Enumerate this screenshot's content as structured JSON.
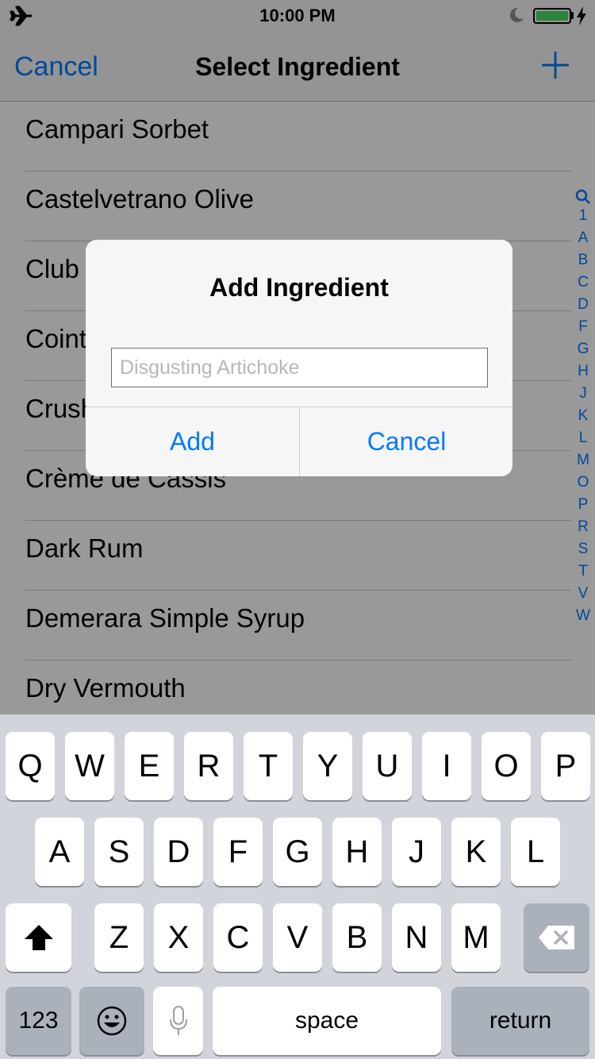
{
  "status_bar": {
    "time": "10:00 PM"
  },
  "nav": {
    "cancel": "Cancel",
    "title": "Select Ingredient"
  },
  "ingredients": [
    "Campari Sorbet",
    "Castelvetrano Olive",
    "Club Soda",
    "Cointreau",
    "Crushed Ice",
    "Crème de Cassis",
    "Dark Rum",
    "Demerara Simple Syrup",
    "Dry Vermouth"
  ],
  "index_letters": [
    "1",
    "A",
    "B",
    "C",
    "D",
    "F",
    "G",
    "H",
    "J",
    "K",
    "L",
    "M",
    "O",
    "P",
    "R",
    "S",
    "T",
    "V",
    "W"
  ],
  "alert": {
    "title": "Add Ingredient",
    "placeholder": "Disgusting Artichoke",
    "add": "Add",
    "cancel": "Cancel"
  },
  "keyboard": {
    "row1": [
      "Q",
      "W",
      "E",
      "R",
      "T",
      "Y",
      "U",
      "I",
      "O",
      "P"
    ],
    "row2": [
      "A",
      "S",
      "D",
      "F",
      "G",
      "H",
      "J",
      "K",
      "L"
    ],
    "row3": [
      "Z",
      "X",
      "C",
      "V",
      "B",
      "N",
      "M"
    ],
    "numbers": "123",
    "space": "space",
    "return": "return"
  },
  "colors": {
    "accent": "#007aff",
    "battery": "#4cd964",
    "keyboard_bg": "#d1d5db"
  }
}
